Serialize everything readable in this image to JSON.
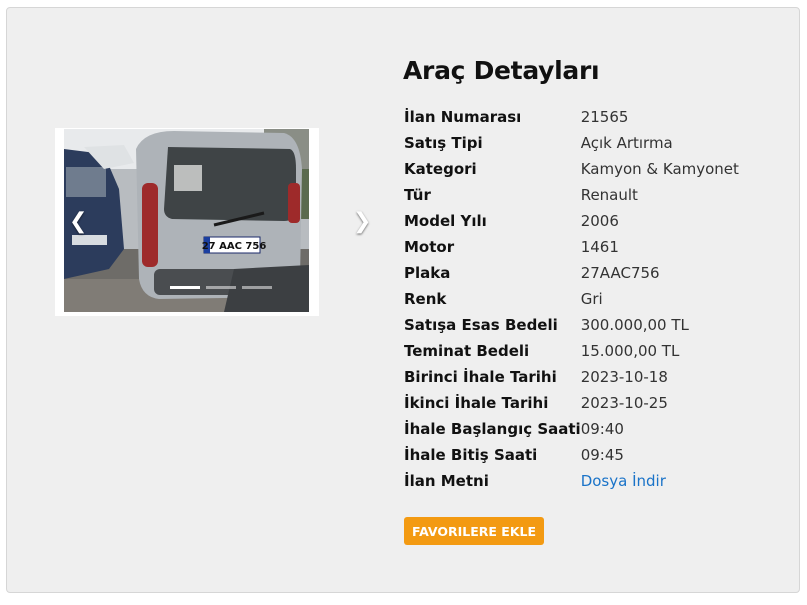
{
  "page": {
    "title": "Araç Detayları"
  },
  "carousel": {
    "plate_text": "27 AAC 756",
    "prev_icon": "chevron-left-icon",
    "next_icon": "chevron-right-icon",
    "slide_count": 3,
    "active_slide": 1
  },
  "details": [
    {
      "label": "İlan Numarası",
      "value": "21565"
    },
    {
      "label": "Satış Tipi",
      "value": "Açık Artırma"
    },
    {
      "label": "Kategori",
      "value": "Kamyon & Kamyonet"
    },
    {
      "label": "Tür",
      "value": "Renault"
    },
    {
      "label": "Model Yılı",
      "value": "2006"
    },
    {
      "label": "Motor",
      "value": "1461"
    },
    {
      "label": "Plaka",
      "value": "27AAC756"
    },
    {
      "label": "Renk",
      "value": "Gri"
    },
    {
      "label": "Satışa Esas Bedeli",
      "value": "300.000,00 TL"
    },
    {
      "label": "Teminat Bedeli",
      "value": "15.000,00 TL"
    },
    {
      "label": "Birinci İhale Tarihi",
      "value": "2023-10-18"
    },
    {
      "label": "İkinci İhale Tarihi",
      "value": "2023-10-25"
    },
    {
      "label": "İhale Başlangıç Saati",
      "value": "09:40"
    },
    {
      "label": "İhale Bitiş Saati",
      "value": "09:45"
    },
    {
      "label": "İlan Metni",
      "value": "Dosya İndir"
    }
  ],
  "actions": {
    "favorite_label": "FAVORILERE EKLE"
  },
  "colors": {
    "accent": "#f39a12",
    "link": "#1a73c8",
    "panel_bg": "#efefef"
  }
}
